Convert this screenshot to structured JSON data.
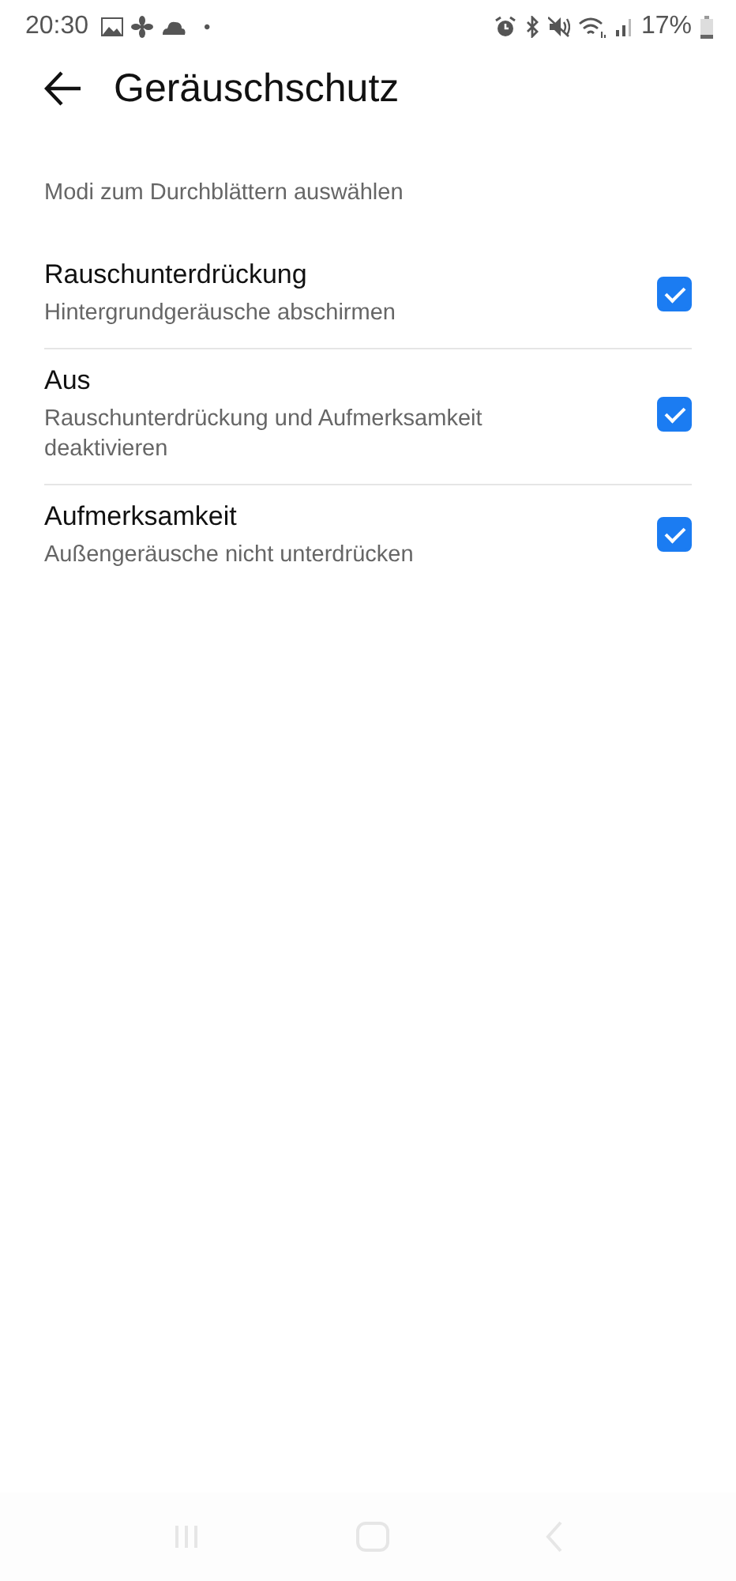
{
  "status_bar": {
    "time": "20:30",
    "dot": "•",
    "battery_percent": "17%"
  },
  "header": {
    "title": "Geräuschschutz"
  },
  "section": {
    "label": "Modi zum Durchblättern auswählen"
  },
  "options": [
    {
      "title": "Rauschunterdrückung",
      "subtitle": "Hintergrundgeräusche abschirmen",
      "checked": true
    },
    {
      "title": "Aus",
      "subtitle": "Rauschunterdrückung und Aufmerksamkeit deaktivieren",
      "checked": true
    },
    {
      "title": "Aufmerksamkeit",
      "subtitle": "Außengeräusche nicht unterdrücken",
      "checked": true
    }
  ]
}
